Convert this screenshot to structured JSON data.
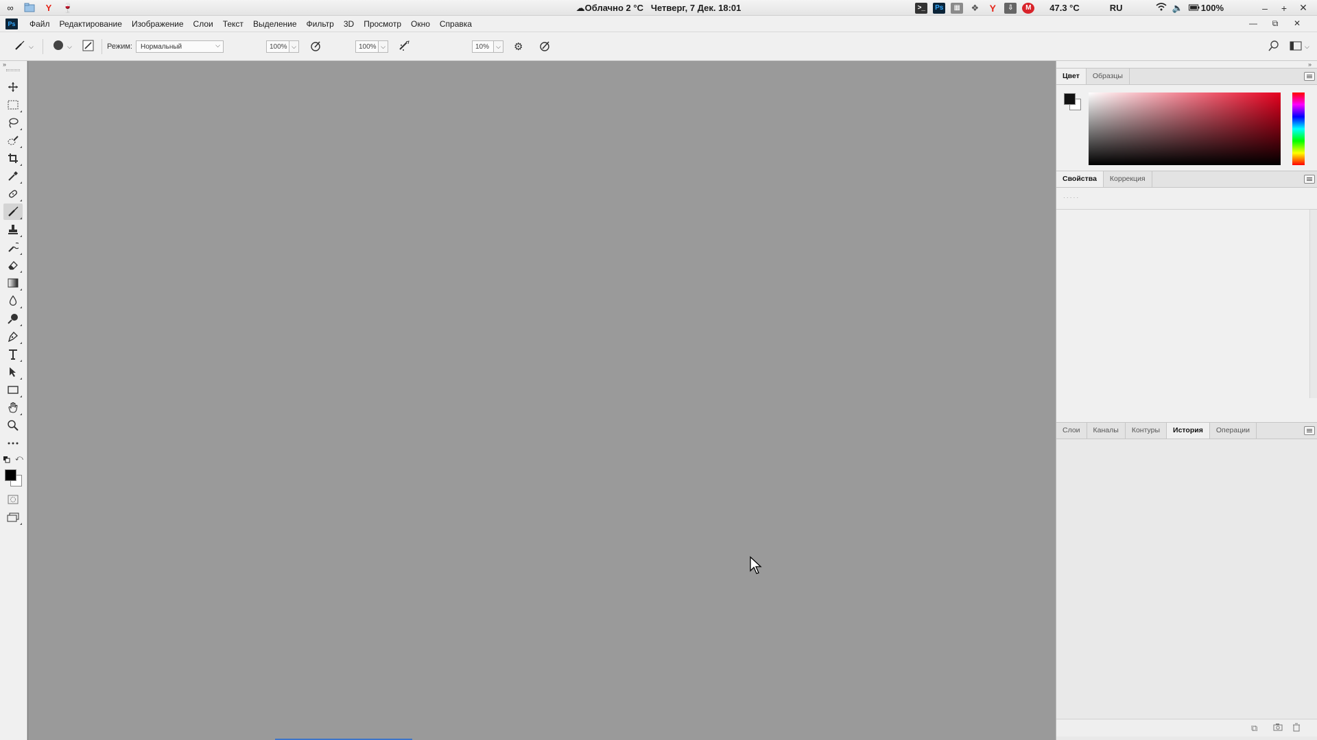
{
  "system_bar": {
    "weather": "☁Облачно 2 °C",
    "datetime": "Четверг, 7 Дек. 18:01",
    "temperature": "47.3 °C",
    "language": "RU",
    "battery": "100%",
    "tray_icons": [
      "terminal-icon",
      "photoshop-icon",
      "monitor-icon",
      "dropbox-icon",
      "yandex-browser-icon",
      "download-icon",
      "mail-icon"
    ]
  },
  "menu": {
    "items": [
      "Файл",
      "Редактирование",
      "Изображение",
      "Слои",
      "Текст",
      "Выделение",
      "Фильтр",
      "3D",
      "Просмотр",
      "Окно",
      "Справка"
    ]
  },
  "options_bar": {
    "mode_label": "Режим:",
    "mode_value": "Нормальный",
    "opacity": "100%",
    "flow": "100%",
    "smoothing": "10%"
  },
  "tools": [
    "move-tool",
    "marquee-tool",
    "lasso-tool",
    "quick-select-tool",
    "crop-tool",
    "eyedropper-tool",
    "healing-brush-tool",
    "brush-tool",
    "clone-stamp-tool",
    "history-brush-tool",
    "eraser-tool",
    "gradient-tool",
    "blur-tool",
    "dodge-tool",
    "pen-tool",
    "type-tool",
    "path-select-tool",
    "rectangle-tool",
    "hand-tool",
    "zoom-tool",
    "more-tools"
  ],
  "panels": {
    "color_tabs": [
      "Цвет",
      "Образцы"
    ],
    "properties_tabs": [
      "Свойства",
      "Коррекция"
    ],
    "history_tabs": [
      "Слои",
      "Каналы",
      "Контуры",
      "История",
      "Операции"
    ]
  },
  "colors": {
    "canvas_bg": "#9a9a9a",
    "foreground": "#000000",
    "background": "#ffffff"
  }
}
